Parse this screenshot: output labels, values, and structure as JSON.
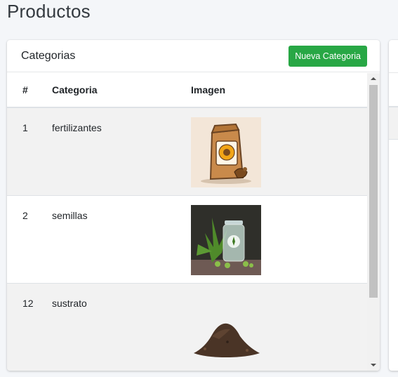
{
  "page": {
    "title": "Productos"
  },
  "card": {
    "title": "Categorias",
    "new_button_label": "Nueva Categoria",
    "columns": {
      "num": "#",
      "category": "Categoria",
      "image": "Imagen"
    },
    "rows": [
      {
        "id": "1",
        "name": "fertilizantes",
        "image": "fertilizer-bag-illustration"
      },
      {
        "id": "2",
        "name": "semillas",
        "image": "seeds-jar-illustration"
      },
      {
        "id": "12",
        "name": "sustrato",
        "image": "soil-pile-photo"
      }
    ]
  },
  "colors": {
    "accent_green": "#28a745",
    "background": "#f4f6f9",
    "stripe": "#f2f2f2"
  }
}
